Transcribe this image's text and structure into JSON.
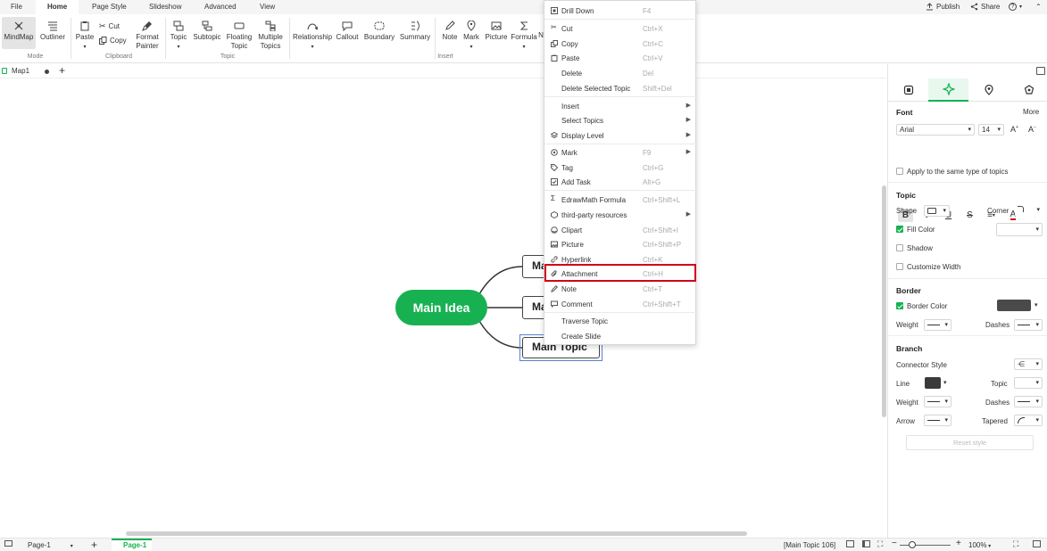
{
  "menubar": {
    "items": [
      "File",
      "Home",
      "Page Style",
      "Slideshow",
      "Advanced",
      "View"
    ],
    "publish": "Publish",
    "share": "Share",
    "help": "?"
  },
  "ribbon": {
    "mode": {
      "mindmap": "MindMap",
      "outliner": "Outliner",
      "group": "Mode"
    },
    "clipboard": {
      "paste": "Paste",
      "cut": "Cut",
      "copy": "Copy",
      "format_painter_1": "Format",
      "format_painter_2": "Painter",
      "group": "Clipboard"
    },
    "topic": {
      "topic": "Topic",
      "subtopic": "Subtopic",
      "floating_1": "Floating",
      "floating_2": "Topic",
      "multiple_1": "Multiple",
      "multiple_2": "Topics",
      "group": "Topic"
    },
    "insert": {
      "relationship": "Relationship",
      "callout": "Callout",
      "boundary": "Boundary",
      "summary": "Summary",
      "note": "Note",
      "mark": "Mark",
      "picture": "Picture",
      "formula": "Formula",
      "extra": "N",
      "group": "Insert"
    }
  },
  "doc_tab": {
    "name": "Map1",
    "add": "+"
  },
  "canvas": {
    "main_idea": "Main Idea",
    "topics": [
      "Mai",
      "Mai",
      "Main Topic"
    ]
  },
  "context_menu": {
    "items": [
      {
        "label": "Drill Down",
        "shortcut": "F4",
        "icon": "drill-icon"
      },
      {
        "label": "Cut",
        "shortcut": "Ctrl+X",
        "icon": "cut-icon"
      },
      {
        "label": "Copy",
        "shortcut": "Ctrl+C",
        "icon": "copy-icon"
      },
      {
        "label": "Paste",
        "shortcut": "Ctrl+V",
        "icon": "paste-icon"
      },
      {
        "label": "Delete",
        "shortcut": "Del",
        "icon": ""
      },
      {
        "label": "Delete Selected Topic",
        "shortcut": "Shift+Del",
        "icon": ""
      },
      {
        "label": "Insert",
        "shortcut": "",
        "icon": ""
      },
      {
        "label": "Select Topics",
        "shortcut": "",
        "icon": ""
      },
      {
        "label": "Display Level",
        "shortcut": "",
        "icon": "layers-icon"
      },
      {
        "label": "Mark",
        "shortcut": "F9",
        "icon": "mark-icon"
      },
      {
        "label": "Tag",
        "shortcut": "Ctrl+G",
        "icon": "tag-icon"
      },
      {
        "label": "Add Task",
        "shortcut": "Alt+G",
        "icon": "task-icon"
      },
      {
        "label": "EdrawMath Formula",
        "shortcut": "Ctrl+Shift+L",
        "icon": "sigma-icon"
      },
      {
        "label": "third-party resources",
        "shortcut": "",
        "icon": "resource-icon"
      },
      {
        "label": "Clipart",
        "shortcut": "Ctrl+Shift+I",
        "icon": "clipart-icon"
      },
      {
        "label": "Picture",
        "shortcut": "Ctrl+Shift+P",
        "icon": "picture-icon"
      },
      {
        "label": "Hyperlink",
        "shortcut": "Ctrl+K",
        "icon": "link-icon"
      },
      {
        "label": "Attachment",
        "shortcut": "Ctrl+H",
        "icon": "paperclip-icon"
      },
      {
        "label": "Note",
        "shortcut": "Ctrl+T",
        "icon": "note-icon"
      },
      {
        "label": "Comment",
        "shortcut": "Ctrl+Shift+T",
        "icon": "comment-icon"
      },
      {
        "label": "Traverse Topic",
        "shortcut": "",
        "icon": ""
      },
      {
        "label": "Create Slide",
        "shortcut": "",
        "icon": ""
      }
    ]
  },
  "panel": {
    "font_title": "Font",
    "more": "More",
    "font_family": "Arial",
    "font_size": "14",
    "format_buttons": [
      "B",
      "I",
      "U",
      "S"
    ],
    "apply_same": "Apply to the same type of topics",
    "topic_title": "Topic",
    "shape": "Shape",
    "corner": "Corner",
    "fill_color": "Fill Color",
    "shadow": "Shadow",
    "customize_width": "Customize Width",
    "border_title": "Border",
    "border_color": "Border Color",
    "border_color_value": "#4a4a4a",
    "weight": "Weight",
    "dashes": "Dashes",
    "branch_title": "Branch",
    "connector_style": "Connector Style",
    "line": "Line",
    "line_color_value": "#3a3a3a",
    "topic": "Topic",
    "arrow": "Arrow",
    "tapered": "Tapered",
    "reset": "Reset style"
  },
  "status": {
    "page_select": "Page-1",
    "page_tab": "Page-1",
    "selection": "[Main Topic 106]",
    "zoom": "100%"
  },
  "colors": {
    "accent": "#17b152",
    "highlight": "#d0021b",
    "selection": "#5b7fd6"
  }
}
